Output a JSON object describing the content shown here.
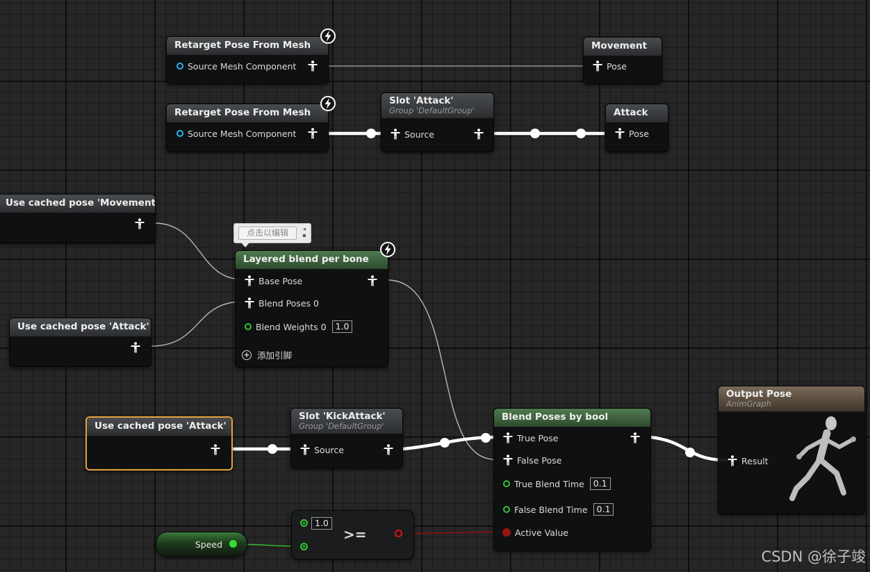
{
  "nodes": {
    "retarget1": {
      "title": "Retarget Pose From Mesh",
      "pin": "Source Mesh Component"
    },
    "movement": {
      "title": "Movement",
      "pin": "Pose"
    },
    "retarget2": {
      "title": "Retarget Pose From Mesh",
      "pin": "Source Mesh Component"
    },
    "slot_attack": {
      "title": "Slot 'Attack'",
      "subtitle": "Group 'DefaultGroup'",
      "pin": "Source"
    },
    "attack": {
      "title": "Attack",
      "pin": "Pose"
    },
    "cached_movement": {
      "title": "Use cached pose 'Movement'"
    },
    "cached_attack1": {
      "title": "Use cached pose 'Attack'"
    },
    "layered": {
      "title": "Layered blend per bone",
      "base_pose": "Base Pose",
      "blend_poses": "Blend Poses 0",
      "blend_weights": "Blend Weights 0",
      "blend_weights_value": "1.0",
      "add_pin": "添加引脚"
    },
    "cached_attack2": {
      "title": "Use cached pose 'Attack'"
    },
    "slot_kick": {
      "title": "Slot 'KickAttack'",
      "subtitle": "Group 'DefaultGroup'",
      "pin": "Source"
    },
    "blend_bool": {
      "title": "Blend Poses by bool",
      "true_pose": "True Pose",
      "false_pose": "False Pose",
      "true_blend_time": "True Blend Time",
      "true_blend_value": "0.1",
      "false_blend_time": "False Blend Time",
      "false_blend_value": "0.1",
      "active_value": "Active Value"
    },
    "output": {
      "title": "Output Pose",
      "subtitle": "AnimGraph",
      "pin": "Result"
    },
    "speed": {
      "label": "Speed"
    },
    "compare": {
      "value": "1.0",
      "operator": ">="
    }
  },
  "tooltip": {
    "text": "点击以编辑"
  },
  "watermark": "CSDN @徐子竣",
  "colors": {
    "pose_wire": "#ffffff",
    "float_pin": "#33c233",
    "bool_pin": "#9b1212",
    "object_pin": "#2fb4ef",
    "selected_border": "#e8a33a"
  },
  "icons": {
    "pose": "pose-pin-icon",
    "fast_path": "lightning-icon",
    "add": "add-pin-icon"
  }
}
